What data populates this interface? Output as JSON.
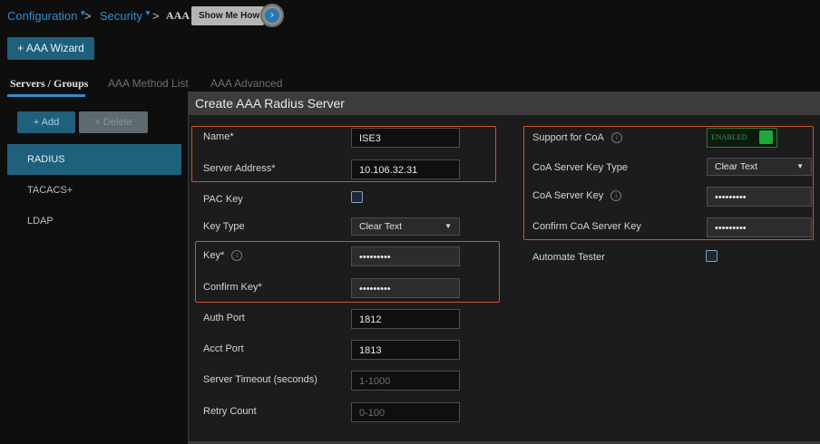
{
  "breadcrumb": {
    "configuration": "Configuration",
    "security": "Security",
    "current": "AAA",
    "show_me_how": "Show Me How"
  },
  "toolbar": {
    "wizard_label": "+ AAA Wizard"
  },
  "tabs": [
    {
      "label": "Servers / Groups",
      "active": true
    },
    {
      "label": "AAA Method List",
      "active": false
    },
    {
      "label": "AAA Advanced",
      "active": false
    }
  ],
  "left_panel": {
    "add_label": "+ Add",
    "delete_label": "× Delete",
    "items": [
      {
        "label": "RADIUS",
        "active": true
      },
      {
        "label": "TACACS+",
        "active": false
      },
      {
        "label": "LDAP",
        "active": false
      }
    ]
  },
  "modal": {
    "title": "Create AAA Radius Server",
    "fields": {
      "name": {
        "label": "Name*",
        "value": "ISE3"
      },
      "server_address": {
        "label": "Server Address*",
        "value": "10.106.32.31"
      },
      "pac_key": {
        "label": "PAC Key"
      },
      "key_type": {
        "label": "Key Type",
        "value": "Clear Text"
      },
      "key": {
        "label": "Key*",
        "value": "•••••••••"
      },
      "confirm_key": {
        "label": "Confirm Key*",
        "value": "•••••••••"
      },
      "auth_port": {
        "label": "Auth Port",
        "value": "1812"
      },
      "acct_port": {
        "label": "Acct Port",
        "value": "1813"
      },
      "server_timeout": {
        "label": "Server Timeout (seconds)",
        "placeholder": "1-1000"
      },
      "retry_count": {
        "label": "Retry Count",
        "placeholder": "0-100"
      },
      "support_coa": {
        "label": "Support for CoA",
        "state": "ENABLED"
      },
      "coa_key_type": {
        "label": "CoA Server Key Type",
        "value": "Clear Text"
      },
      "coa_key": {
        "label": "CoA Server Key",
        "value": "•••••••••"
      },
      "confirm_coa_key": {
        "label": "Confirm CoA Server Key",
        "value": "•••••••••"
      },
      "automate_tester": {
        "label": "Automate Tester"
      }
    }
  },
  "colors": {
    "accent_blue": "#2f8fd0",
    "button_teal": "#1f607d",
    "highlight_orange": "#d0522c",
    "toggle_green": "#1ea83a"
  }
}
